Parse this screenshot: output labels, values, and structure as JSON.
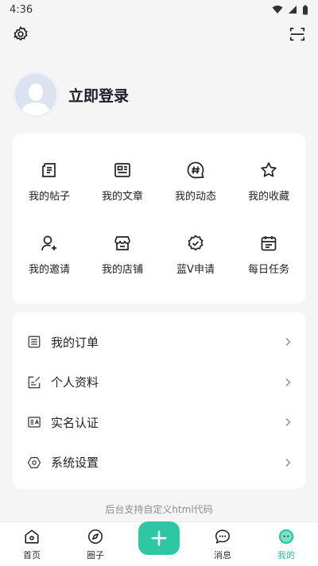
{
  "status": {
    "time": "4:36"
  },
  "profile": {
    "login_label": "立即登录"
  },
  "shortcuts": [
    {
      "label": "我的帖子",
      "icon": "post-icon"
    },
    {
      "label": "我的文章",
      "icon": "article-icon"
    },
    {
      "label": "我的动态",
      "icon": "hashtag-icon"
    },
    {
      "label": "我的收藏",
      "icon": "star-icon"
    },
    {
      "label": "我的邀请",
      "icon": "user-plus-icon"
    },
    {
      "label": "我的店铺",
      "icon": "store-icon"
    },
    {
      "label": "蓝V申请",
      "icon": "verified-badge-icon"
    },
    {
      "label": "每日任务",
      "icon": "calendar-icon"
    }
  ],
  "menu": [
    {
      "label": "我的订单",
      "icon": "order-list-icon"
    },
    {
      "label": "个人资料",
      "icon": "edit-profile-icon"
    },
    {
      "label": "实名认证",
      "icon": "id-card-icon"
    },
    {
      "label": "系统设置",
      "icon": "settings-hex-icon"
    }
  ],
  "footer_note": "后台支持自定义html代码",
  "tabbar": {
    "home": "首页",
    "circle": "圈子",
    "messages": "消息",
    "mine": "我的"
  },
  "colors": {
    "accent": "#2ec7a4",
    "active_tab": "#27c4a0"
  }
}
